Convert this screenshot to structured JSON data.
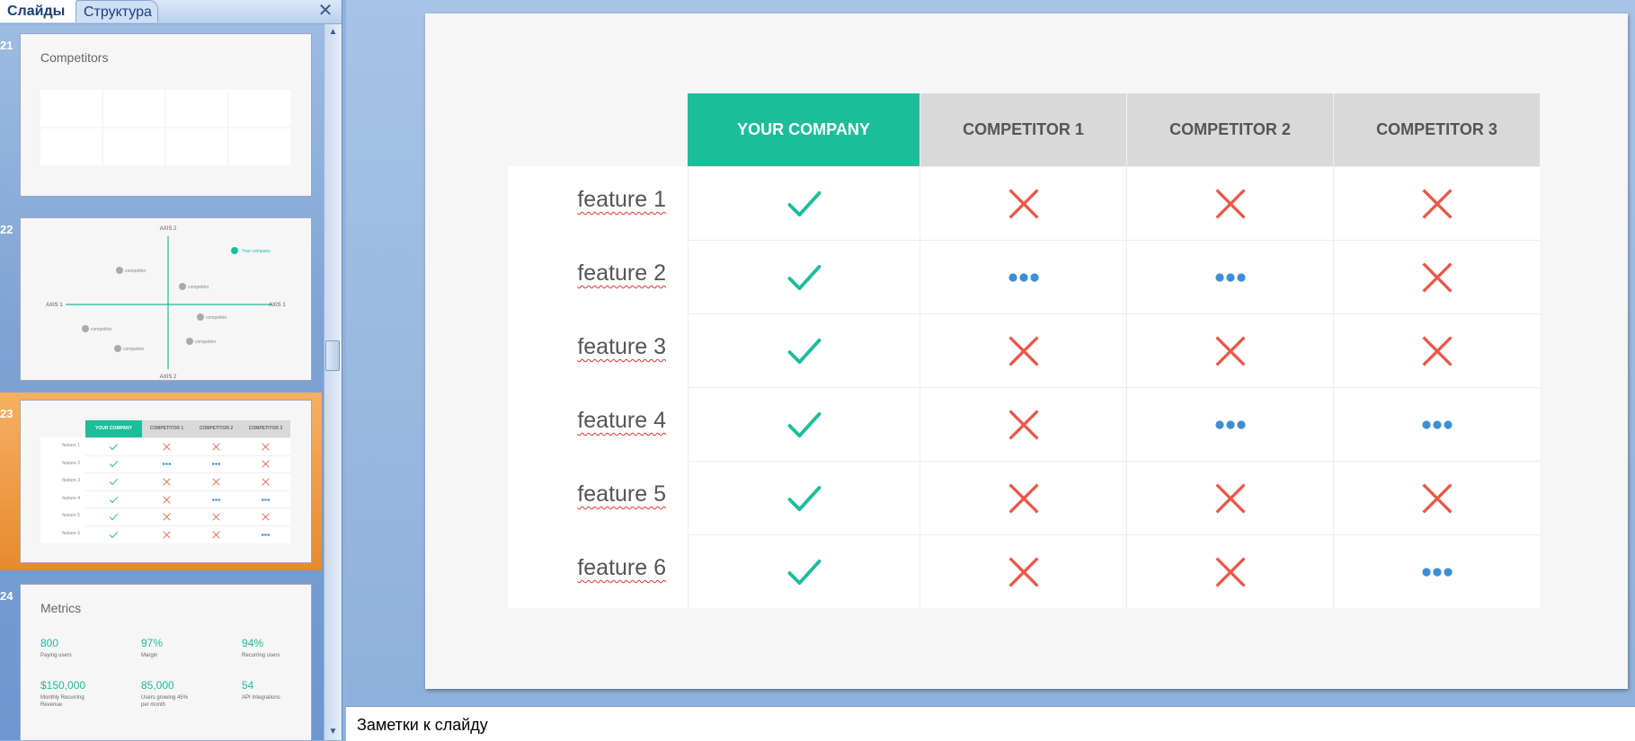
{
  "panel": {
    "tabs": [
      {
        "label": "Слайды"
      },
      {
        "label": "Структура"
      }
    ],
    "close_glyph": "✕"
  },
  "thumbnails": [
    {
      "number": "21",
      "title": "Competitors"
    },
    {
      "number": "22",
      "axis_top": "AXIS 2",
      "axis_bottom": "AXIS 2",
      "axis_left": "AXIS 1",
      "axis_right": "AXIS 1",
      "highlight_label": "Your company",
      "point_label": "competitor"
    },
    {
      "number": "23"
    },
    {
      "number": "24",
      "title": "Metrics",
      "metrics": [
        {
          "value": "800",
          "label": "Paying users"
        },
        {
          "value": "97%",
          "label": "Margin"
        },
        {
          "value": "94%",
          "label": "Recurring users"
        },
        {
          "value": "$150,000",
          "label": "Monthly Recurring Revenue"
        },
        {
          "value": "85,000",
          "label": "Users growing 45% per month"
        },
        {
          "value": "54",
          "label": "API Integrations"
        }
      ]
    }
  ],
  "slide": {
    "columns": [
      "YOUR COMPANY",
      "COMPETITOR  1",
      "COMPETITOR  2",
      "COMPETITOR  3"
    ],
    "rows": [
      {
        "feature": "feature 1",
        "marks": [
          "check",
          "cross",
          "cross",
          "cross"
        ]
      },
      {
        "feature": "feature 2",
        "marks": [
          "check",
          "dots",
          "dots",
          "cross"
        ]
      },
      {
        "feature": "feature 3",
        "marks": [
          "check",
          "cross",
          "cross",
          "cross"
        ]
      },
      {
        "feature": "feature 4",
        "marks": [
          "check",
          "cross",
          "dots",
          "dots"
        ]
      },
      {
        "feature": "feature 5",
        "marks": [
          "check",
          "cross",
          "cross",
          "cross"
        ]
      },
      {
        "feature": "feature 6",
        "marks": [
          "check",
          "cross",
          "cross",
          "dots"
        ]
      }
    ]
  },
  "notes": {
    "placeholder": "Заметки к слайду"
  },
  "colors": {
    "check": "#1cbd9a",
    "cross": "#e8584a",
    "dots": "#3a8fd6",
    "company_header": "#1cbd9a"
  },
  "icons": {
    "check": "check-icon",
    "cross": "cross-icon",
    "dots": "dots-icon"
  }
}
